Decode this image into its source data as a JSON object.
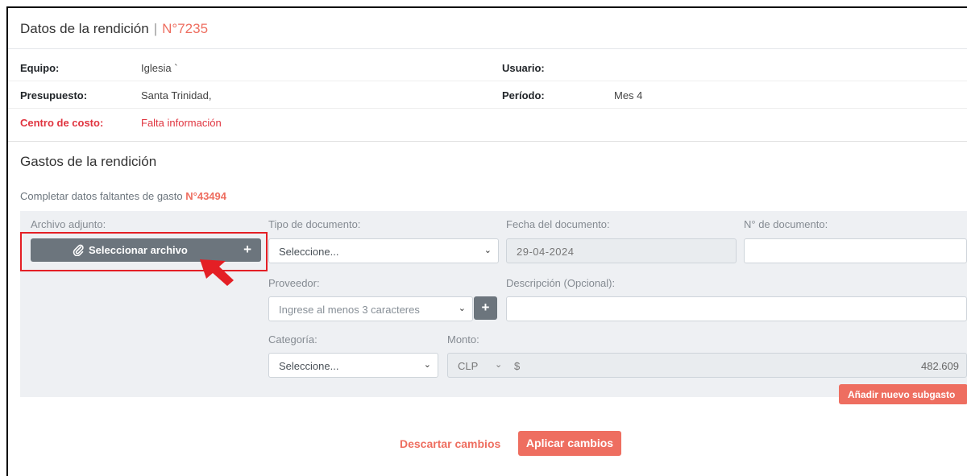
{
  "header": {
    "title": "Datos de la rendición",
    "separator": "|",
    "number": "N°7235"
  },
  "info": {
    "equipo_label": "Equipo:",
    "equipo_value": "Iglesia `",
    "usuario_label": "Usuario:",
    "usuario_value": "",
    "presupuesto_label": "Presupuesto:",
    "presupuesto_value": "Santa Trinidad,",
    "periodo_label": "Período:",
    "periodo_value": "Mes 4",
    "centro_label": "Centro de costo:",
    "centro_value": "Falta información"
  },
  "gastos": {
    "title": "Gastos de la rendición",
    "subtitle_prefix": "Completar datos faltantes de gasto",
    "subtitle_number": "N°43494"
  },
  "form": {
    "archivo_label": "Archivo adjunto:",
    "archivo_button": "Seleccionar archivo",
    "archivo_plus": "+",
    "tipo_label": "Tipo de documento:",
    "tipo_value": "Seleccione...",
    "fecha_label": "Fecha del documento:",
    "fecha_value": "29-04-2024",
    "ndoc_label": "N° de documento:",
    "ndoc_value": "",
    "proveedor_label": "Proveedor:",
    "proveedor_placeholder": "Ingrese al menos 3 caracteres",
    "proveedor_plus": "+",
    "descripcion_label": "Descripción (Opcional):",
    "descripcion_value": "",
    "categoria_label": "Categoría:",
    "categoria_value": "Seleccione...",
    "monto_label": "Monto:",
    "monto_currency": "CLP",
    "monto_symbol": "$",
    "monto_value": "482.609",
    "subgasto_button": "Añadir nuevo subgasto"
  },
  "actions": {
    "discard": "Descartar cambios",
    "apply": "Aplicar cambios"
  },
  "colors": {
    "accent": "#ee6e60",
    "warning_text": "#e0343f",
    "highlight_box": "#e41f25",
    "button_gray": "#6c757d"
  }
}
